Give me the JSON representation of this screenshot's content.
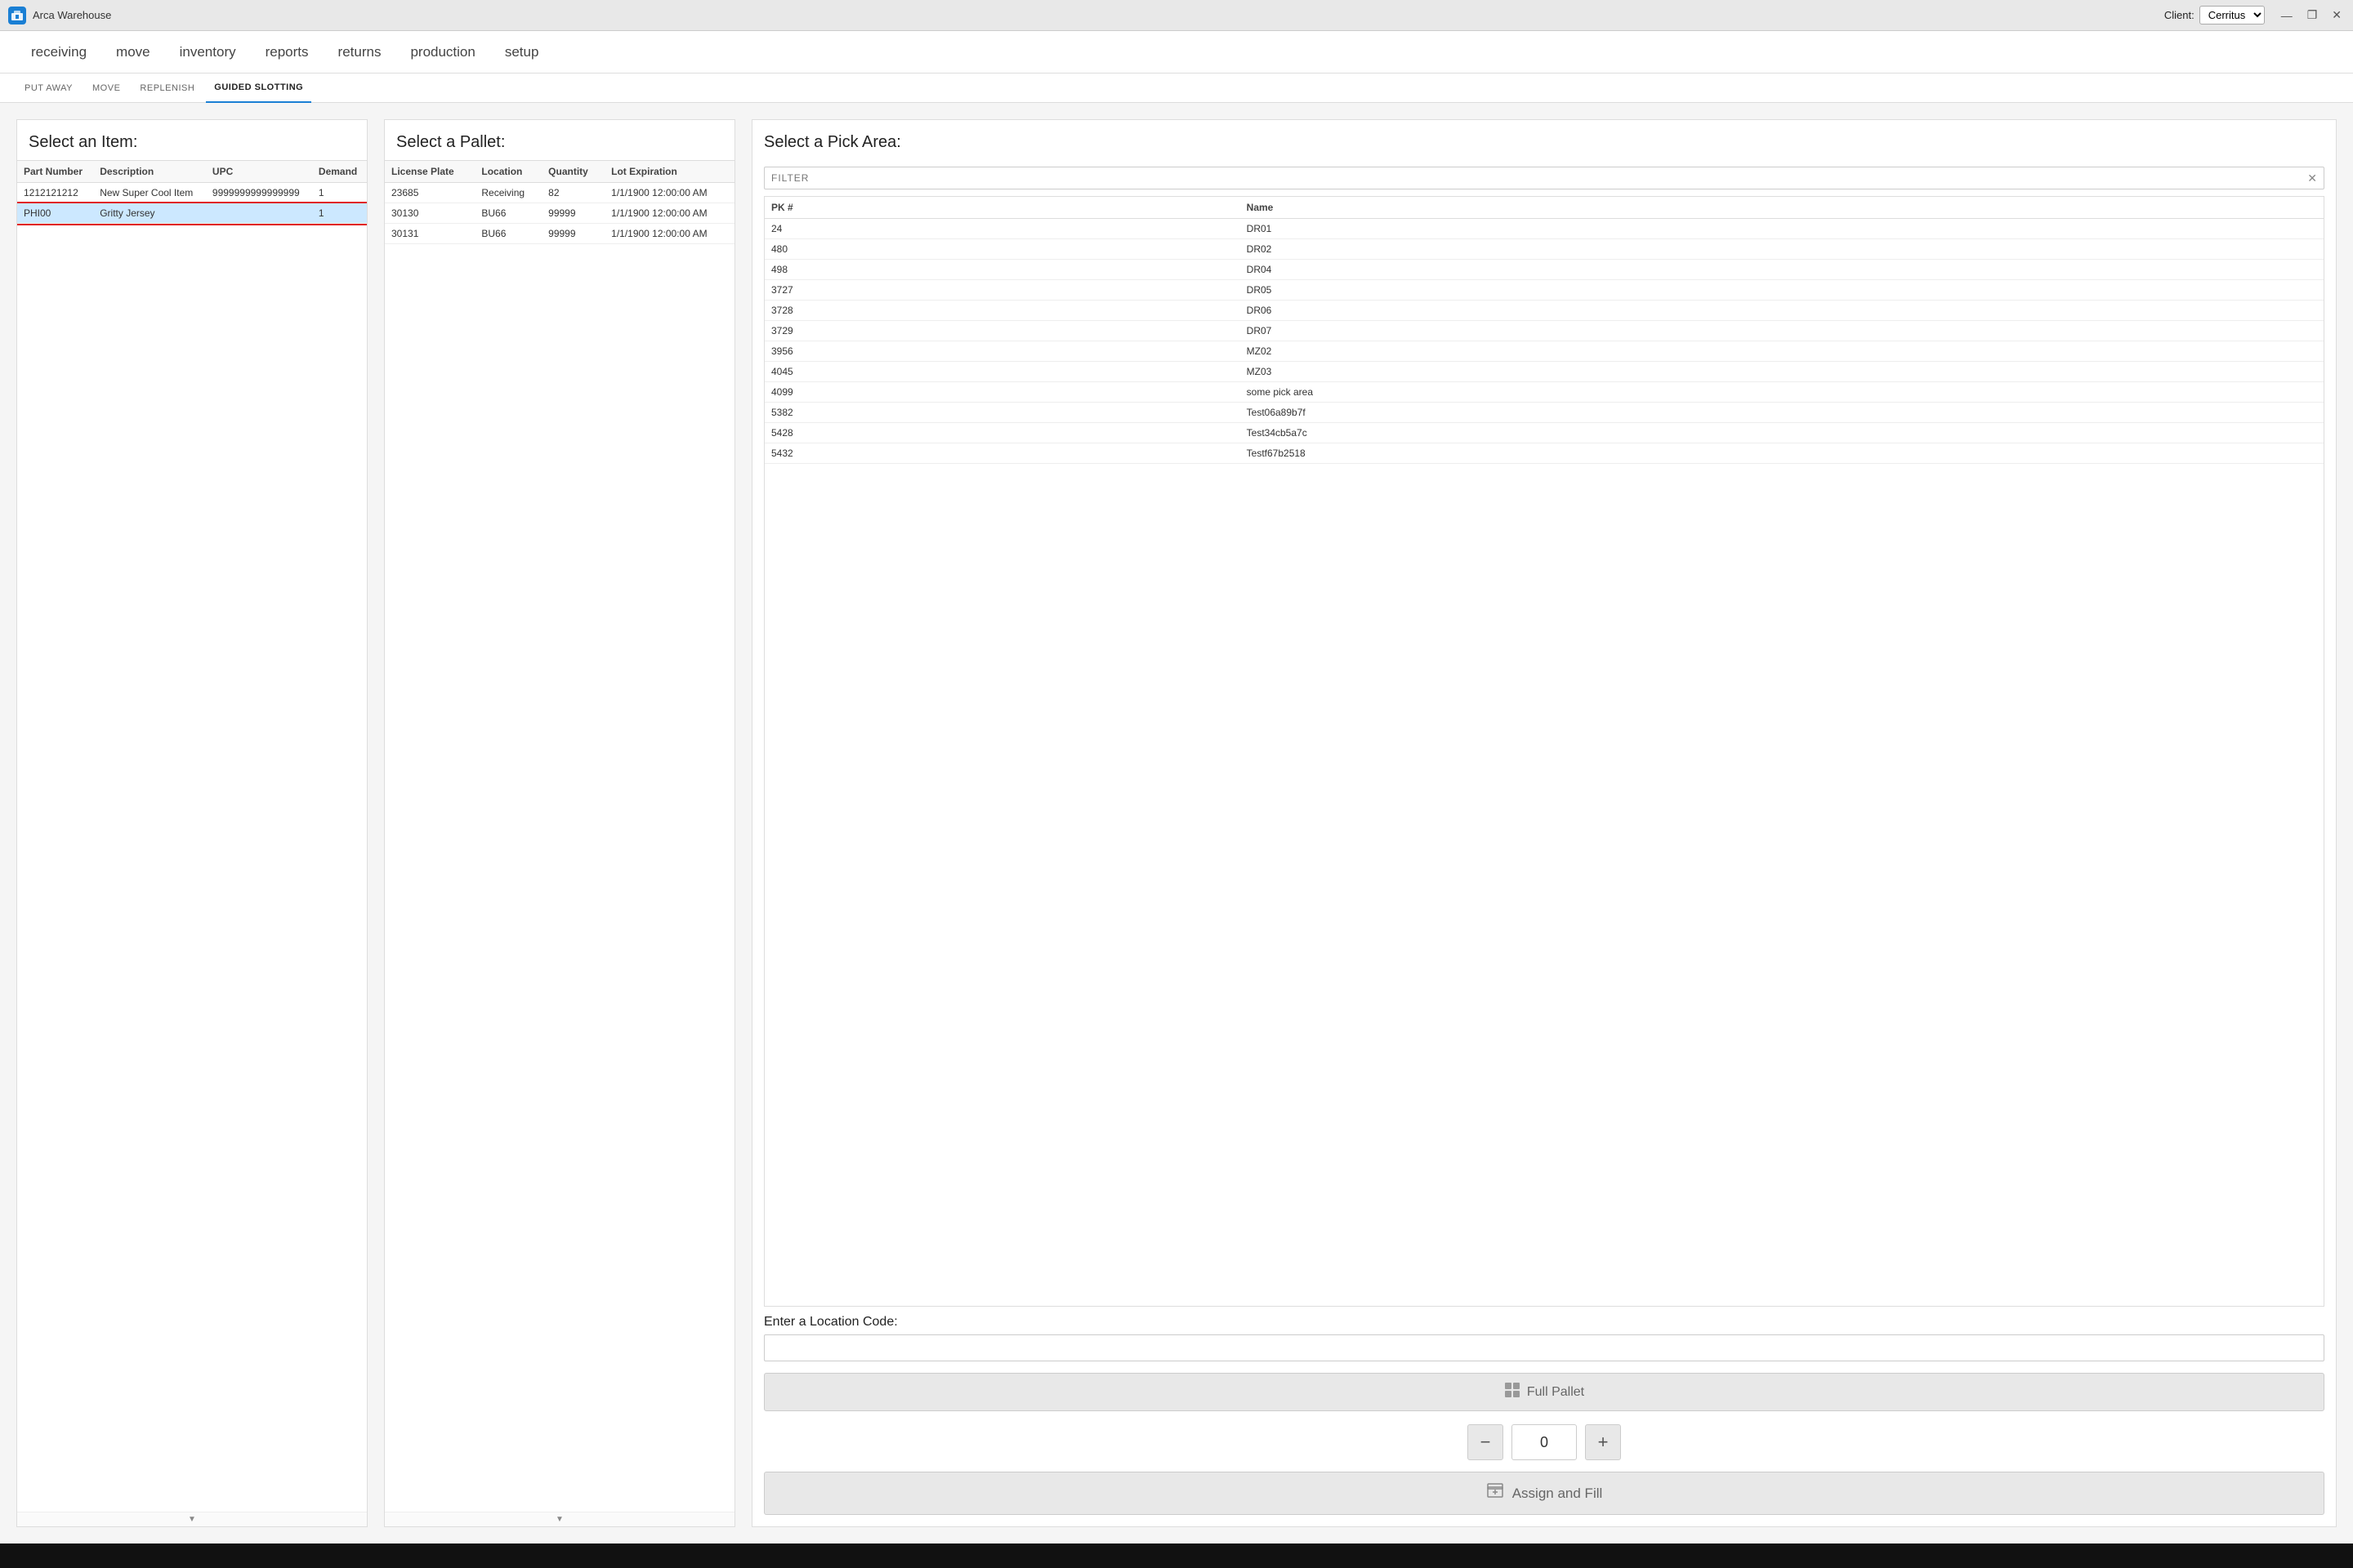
{
  "titlebar": {
    "app_icon_text": "A",
    "app_title": "Arca Warehouse",
    "client_label": "Client:",
    "client_value": "Cerritus",
    "client_options": [
      "Cerritus"
    ],
    "win_minimize": "—",
    "win_maximize": "❐",
    "win_close": "✕"
  },
  "navbar": {
    "items": [
      {
        "id": "receiving",
        "label": "receiving"
      },
      {
        "id": "move",
        "label": "move"
      },
      {
        "id": "inventory",
        "label": "inventory"
      },
      {
        "id": "reports",
        "label": "reports"
      },
      {
        "id": "returns",
        "label": "returns"
      },
      {
        "id": "production",
        "label": "production"
      },
      {
        "id": "setup",
        "label": "setup"
      }
    ]
  },
  "subnav": {
    "items": [
      {
        "id": "put-away",
        "label": "PUT AWAY"
      },
      {
        "id": "move",
        "label": "MOVE"
      },
      {
        "id": "replenish",
        "label": "REPLENISH"
      },
      {
        "id": "guided-slotting",
        "label": "GUIDED SLOTTING",
        "active": true
      }
    ]
  },
  "item_panel": {
    "title": "Select an Item:",
    "columns": [
      "Part Number",
      "Description",
      "UPC",
      "Demand"
    ],
    "rows": [
      {
        "part_number": "1212121212",
        "description": "New Super Cool Item",
        "upc": "9999999999999999",
        "demand": "1",
        "selected": false
      },
      {
        "part_number": "PHI00",
        "description": "Gritty Jersey",
        "upc": "",
        "demand": "1",
        "selected": true
      }
    ]
  },
  "pallet_panel": {
    "title": "Select a Pallet:",
    "columns": [
      "License Plate",
      "Location",
      "Quantity",
      "Lot Expiration"
    ],
    "rows": [
      {
        "license_plate": "23685",
        "location": "Receiving",
        "quantity": "82",
        "lot_expiration": "1/1/1900 12:00:00 AM"
      },
      {
        "license_plate": "30130",
        "location": "BU66",
        "quantity": "99999",
        "lot_expiration": "1/1/1900 12:00:00 AM"
      },
      {
        "license_plate": "30131",
        "location": "BU66",
        "quantity": "99999",
        "lot_expiration": "1/1/1900 12:00:00 AM"
      }
    ]
  },
  "pick_panel": {
    "title": "Select a Pick Area:",
    "filter_placeholder": "FILTER",
    "columns": [
      {
        "id": "pk",
        "label": "PK #"
      },
      {
        "id": "name",
        "label": "Name"
      }
    ],
    "rows": [
      {
        "pk": "24",
        "name": "DR01"
      },
      {
        "pk": "480",
        "name": "DR02"
      },
      {
        "pk": "498",
        "name": "DR04"
      },
      {
        "pk": "3727",
        "name": "DR05"
      },
      {
        "pk": "3728",
        "name": "DR06"
      },
      {
        "pk": "3729",
        "name": "DR07"
      },
      {
        "pk": "3956",
        "name": "MZ02"
      },
      {
        "pk": "4045",
        "name": "MZ03"
      },
      {
        "pk": "4099",
        "name": "some pick area"
      },
      {
        "pk": "5382",
        "name": "Test06a89b7f"
      },
      {
        "pk": "5428",
        "name": "Test34cb5a7c"
      },
      {
        "pk": "5432",
        "name": "Testf67b2518"
      }
    ],
    "location_label": "Enter a Location Code:",
    "location_placeholder": "",
    "full_pallet_label": "Full Pallet",
    "qty_value": "0",
    "qty_minus": "−",
    "qty_plus": "+",
    "assign_fill_label": "Assign and Fill"
  }
}
